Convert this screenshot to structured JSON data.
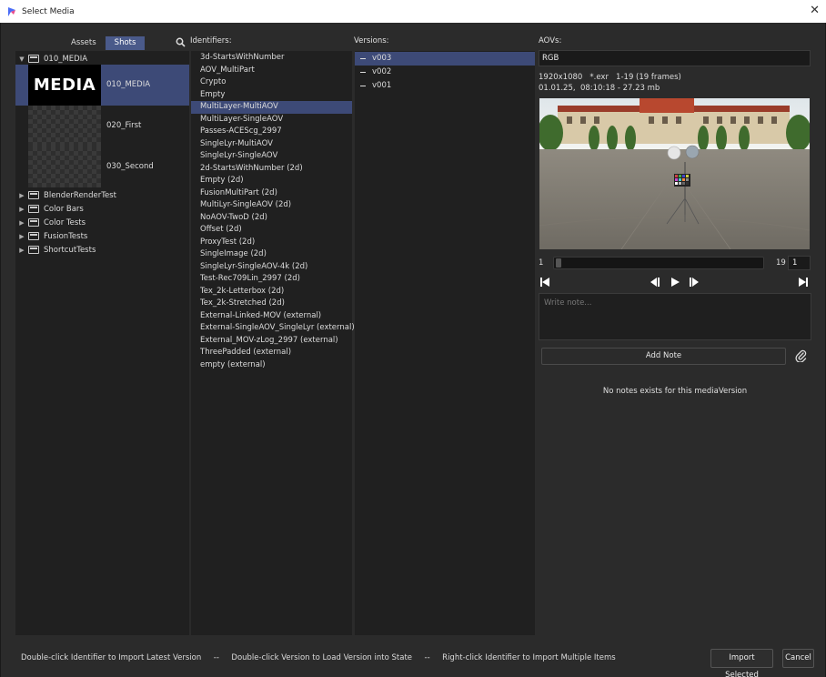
{
  "window": {
    "title": "Select Media",
    "close_glyph": "✕"
  },
  "left": {
    "tabs": [
      {
        "label": "Assets",
        "active": false
      },
      {
        "label": "Shots",
        "active": true
      }
    ],
    "root": {
      "label": "010_MEDIA",
      "expanded": true
    },
    "shots": [
      {
        "label": "010_MEDIA",
        "thumb_text": "MEDIA",
        "selected": true
      },
      {
        "label": "020_First",
        "thumb_text": "",
        "selected": false
      },
      {
        "label": "030_Second",
        "thumb_text": "",
        "selected": false
      }
    ],
    "folders": [
      "BlenderRenderTest",
      "Color Bars",
      "Color Tests",
      "FusionTests",
      "ShortcutTests"
    ]
  },
  "identifiers": {
    "header": "Identifiers:",
    "items": [
      "3d-StartsWithNumber",
      "AOV_MultiPart",
      "Crypto",
      "Empty",
      "MultiLayer-MultiAOV",
      "MultiLayer-SingleAOV",
      "Passes-ACEScg_2997",
      "SingleLyr-MultiAOV",
      "SingleLyr-SingleAOV",
      "2d-StartsWithNumber (2d)",
      "Empty (2d)",
      "FusionMultiPart (2d)",
      "MultiLyr-SingleAOV (2d)",
      "NoAOV-TwoD (2d)",
      "Offset (2d)",
      "ProxyTest (2d)",
      "SingleImage (2d)",
      "SingleLyr-SingleAOV-4k (2d)",
      "Test-Rec709Lin_2997 (2d)",
      "Tex_2k-Letterbox (2d)",
      "Tex_2k-Stretched (2d)",
      "External-Linked-MOV (external)",
      "External-SingleAOV_SingleLyr (external)",
      "External_MOV-zLog_2997 (external)",
      "ThreePadded (external)",
      "empty (external)"
    ],
    "selected_index": 4
  },
  "versions": {
    "header": "Versions:",
    "items": [
      "v003",
      "v002",
      "v001"
    ],
    "selected_index": 0
  },
  "aovs": {
    "header": "AOVs:",
    "current": "RGB",
    "meta_line1": "1920x1080   *.exr   1-19 (19 frames)",
    "meta_line2": "01.01.25,  08:10:18 - 27.23 mb"
  },
  "player": {
    "frame_start": "1",
    "frame_end": "19",
    "current_frame": "1",
    "progress": 0.0
  },
  "notes": {
    "placeholder": "Write note...",
    "add_label": "Add Note",
    "empty_text": "No notes exists for this mediaVersion"
  },
  "footer": {
    "hint": "Double-click Identifier to Import Latest Version     --     Double-click Version to Load Version into State     --     Right-click Identifier to Import Multiple Items",
    "import_label": "Import Selected",
    "cancel_label": "Cancel"
  },
  "colors": {
    "selection": "#3d4a77",
    "panel": "#202020",
    "background": "#2b2b2b"
  }
}
